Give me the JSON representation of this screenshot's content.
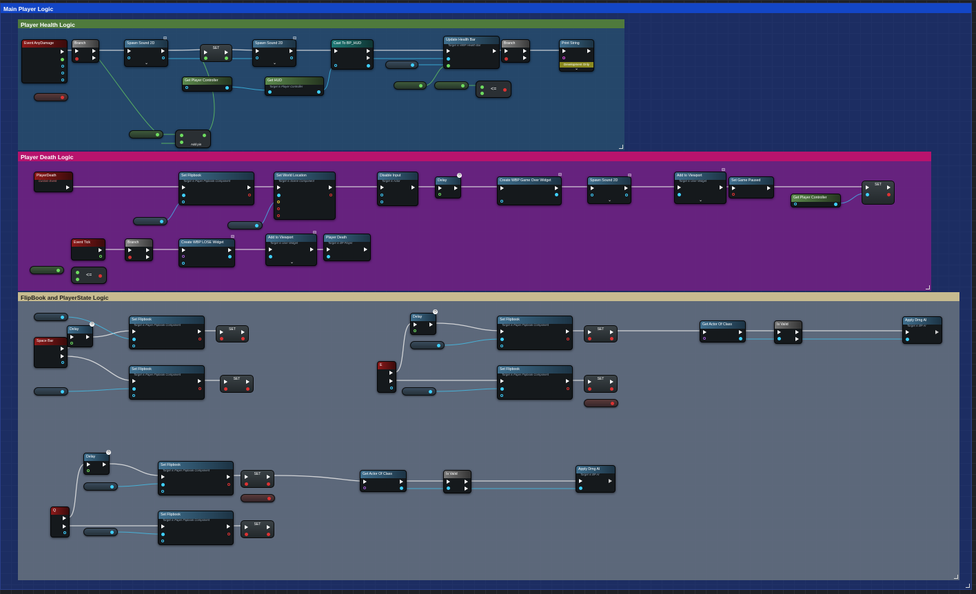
{
  "comments": {
    "main": "Main Player Logic",
    "health": "Player Health Logic",
    "death": "Player Death Logic",
    "flip": "FlipBook and  PlayerState Logic"
  },
  "nodes": {
    "event_any_damage": "Event AnyDamage",
    "branch": "Branch",
    "spawn_sound_2d": "Spawn Sound 2D",
    "set": "SET",
    "cast_bp_hud": "Cast To BP_HUD",
    "get_player_controller": "Get Player Controller",
    "get_hud": "Get HUD",
    "get_hud_target": "Target is Player Controller",
    "update_health_bar": "Update Health Bar",
    "update_health_bar_target": "Target is WBP Health Bar",
    "print_string": "Print String",
    "development_only": "Development Only",
    "add_pin": "Add pin",
    "player_death_event": "PlayerDeath",
    "custom_event": "Custom Event",
    "set_flipbook": "Set Flipbook",
    "flipbook_target": "Target is Paper Flipbook Component",
    "set_world_location": "Set World Location",
    "set_world_location_target": "Target is Scene Component",
    "disable_input": "Disable Input",
    "disable_input_target": "Target is Actor",
    "delay": "Delay",
    "create_game_over": "Create WBP Game Over Widget",
    "add_to_viewport": "Add to Viewport",
    "user_widget_target": "Target is User Widget",
    "set_game_paused": "Set Game Paused",
    "event_tick": "Event Tick",
    "create_lose": "Create WBP LOSE Widget",
    "player_death_call": "Player Death",
    "player_death_target": "Target is BP Player",
    "space_bar": "Space Bar",
    "key_e": "E",
    "key_q": "Q",
    "get_actor_of_class": "Get Actor Of Class",
    "is_valid": "Is Valid",
    "apply_dmg_ai": "Apply Dmg AI",
    "apply_dmg_target": "Target is BP AI",
    "lte": "<="
  }
}
